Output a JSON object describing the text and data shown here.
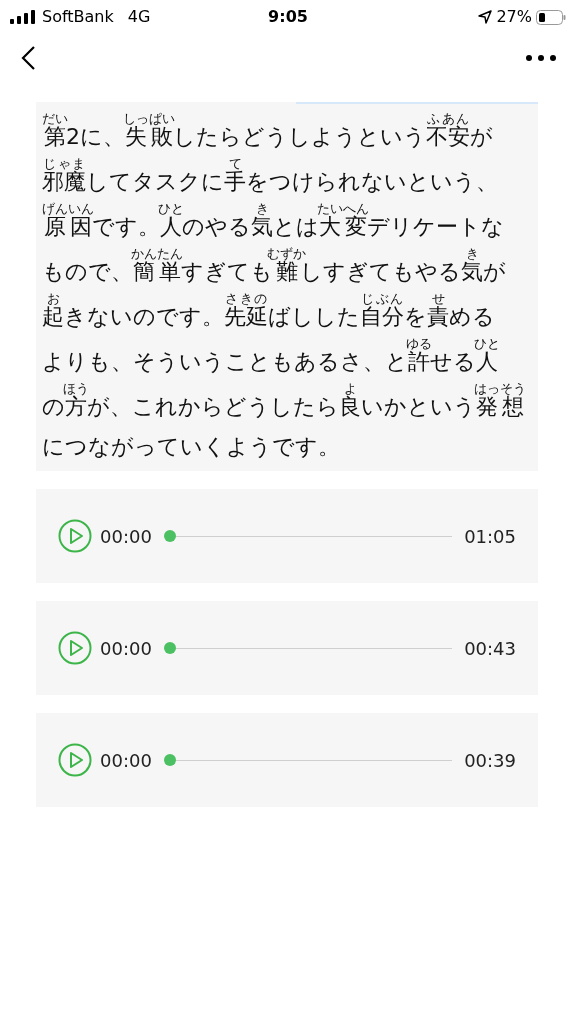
{
  "status_bar": {
    "carrier": "SoftBank",
    "network": "4G",
    "time": "9:05",
    "battery": "27%"
  },
  "passage": {
    "lines": [
      [
        {
          "base": "第",
          "ruby": "だい"
        },
        {
          "base": "2に、"
        },
        {
          "base": "失敗",
          "ruby": "しっぱい"
        },
        {
          "base": "したらどうしようという"
        },
        {
          "base": "不安",
          "ruby": "ふあん"
        },
        {
          "base": "が"
        }
      ],
      [
        {
          "base": "邪魔",
          "ruby": "じゃま"
        },
        {
          "base": "してタスクに"
        },
        {
          "base": "手",
          "ruby": "て"
        },
        {
          "base": "をつけられないという、"
        }
      ],
      [
        {
          "base": "原因",
          "ruby": "げんいん"
        },
        {
          "base": "です。"
        },
        {
          "base": "人",
          "ruby": "ひと"
        },
        {
          "base": "のやる"
        },
        {
          "base": "気",
          "ruby": "き"
        },
        {
          "base": "とは"
        },
        {
          "base": "大変",
          "ruby": "たいへん"
        },
        {
          "base": "デリケートな"
        }
      ],
      [
        {
          "base": "もので、"
        },
        {
          "base": "簡単",
          "ruby": "かんたん"
        },
        {
          "base": "すぎても"
        },
        {
          "base": "難",
          "ruby": "むずか"
        },
        {
          "base": "しすぎてもやる"
        },
        {
          "base": "気",
          "ruby": "き"
        },
        {
          "base": "が"
        }
      ],
      [
        {
          "base": "起",
          "ruby": "お"
        },
        {
          "base": "きないのです。"
        },
        {
          "base": "先延",
          "ruby": "さきの"
        },
        {
          "base": "ばしした"
        },
        {
          "base": "自分",
          "ruby": "じぶん"
        },
        {
          "base": "を"
        },
        {
          "base": "責",
          "ruby": "せ"
        },
        {
          "base": "める"
        }
      ],
      [
        {
          "base": "よりも、そういうこともあるさ、と"
        },
        {
          "base": "許",
          "ruby": "ゆる"
        },
        {
          "base": "せる"
        },
        {
          "base": "人",
          "ruby": "ひと"
        }
      ],
      [
        {
          "base": "の"
        },
        {
          "base": "方",
          "ruby": "ほう"
        },
        {
          "base": "が、これからどうしたら"
        },
        {
          "base": "良",
          "ruby": "よ"
        },
        {
          "base": "いかという"
        },
        {
          "base": "発想",
          "ruby": "はっそう"
        }
      ],
      [
        {
          "base": "につながっていくようです。"
        }
      ]
    ]
  },
  "players": [
    {
      "elapsed": "00:00",
      "level": 0,
      "duration": "01:05"
    },
    {
      "elapsed": "00:00",
      "level": 0,
      "duration": "00:43"
    },
    {
      "elapsed": "00:00",
      "level": 0,
      "duration": "00:39"
    }
  ]
}
